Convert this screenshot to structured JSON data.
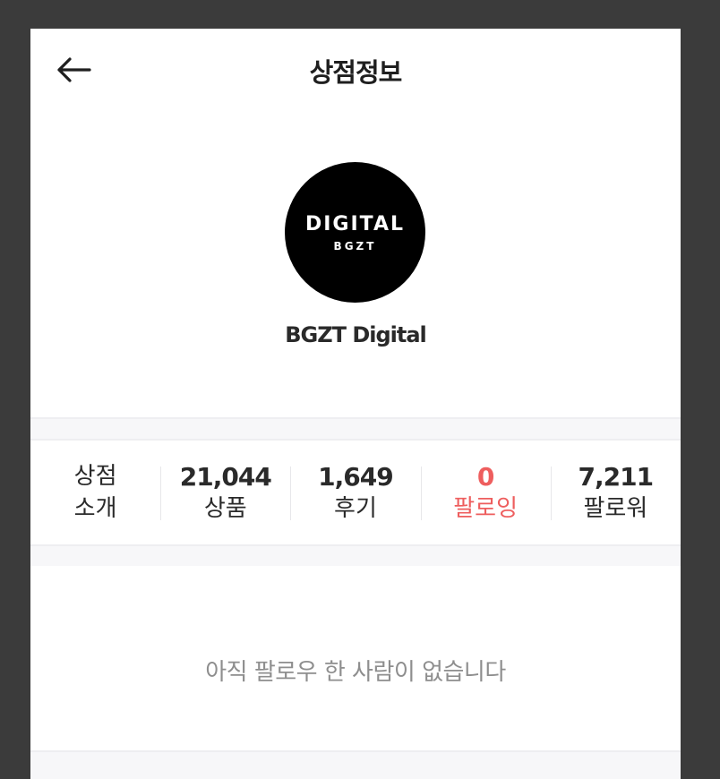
{
  "header": {
    "title": "상점정보",
    "back_icon": "arrow-left-icon"
  },
  "store": {
    "logo_main": "DIGITAL",
    "logo_sub": "BGZT",
    "name": "BGZT Digital"
  },
  "stats": {
    "intro_line1": "상점",
    "intro_line2": "소개",
    "products": {
      "value": "21,044",
      "label": "상품"
    },
    "reviews": {
      "value": "1,649",
      "label": "후기"
    },
    "following": {
      "value": "0",
      "label": "팔로잉"
    },
    "followers": {
      "value": "7,211",
      "label": "팔로워"
    }
  },
  "empty_message": "아직 팔로우 한 사람이 없습니다",
  "colors": {
    "accent": "#ee5e5e",
    "background": "#3b3b3b",
    "panel": "#ffffff"
  }
}
